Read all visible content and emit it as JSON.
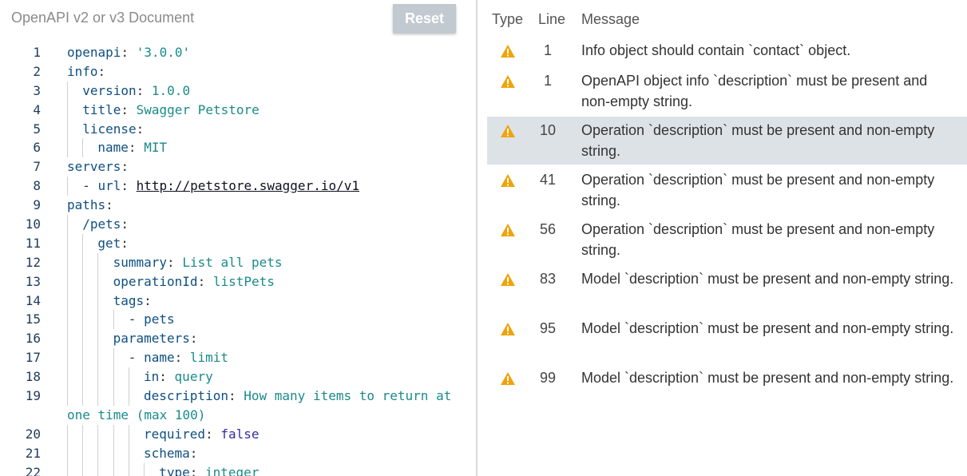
{
  "editor": {
    "title": "OpenAPI v2 or v3 Document",
    "reset_label": "Reset",
    "lines": [
      {
        "n": "1",
        "indent": 0,
        "key": "openapi",
        "value": "'3.0.0'",
        "vclass": "v"
      },
      {
        "n": "2",
        "indent": 0,
        "key": "info",
        "value": "",
        "vclass": "v"
      },
      {
        "n": "3",
        "indent": 1,
        "key": "version",
        "value": "1.0.0",
        "vclass": "v"
      },
      {
        "n": "4",
        "indent": 1,
        "key": "title",
        "value": "Swagger Petstore",
        "vclass": "v"
      },
      {
        "n": "5",
        "indent": 1,
        "key": "license",
        "value": "",
        "vclass": "v"
      },
      {
        "n": "6",
        "indent": 2,
        "key": "name",
        "value": "MIT",
        "vclass": "v"
      },
      {
        "n": "7",
        "indent": 0,
        "key": "servers",
        "value": "",
        "vclass": "v"
      },
      {
        "n": "8",
        "indent": 1,
        "dash": true,
        "key": "url",
        "value": "http://petstore.swagger.io/v1",
        "vclass": "url"
      },
      {
        "n": "9",
        "indent": 0,
        "key": "paths",
        "value": "",
        "vclass": "v"
      },
      {
        "n": "10",
        "indent": 1,
        "key": "/pets",
        "value": "",
        "vclass": "v"
      },
      {
        "n": "11",
        "indent": 2,
        "key": "get",
        "value": "",
        "vclass": "v"
      },
      {
        "n": "12",
        "indent": 3,
        "key": "summary",
        "value": "List all pets",
        "vclass": "v"
      },
      {
        "n": "13",
        "indent": 3,
        "key": "operationId",
        "value": "listPets",
        "vclass": "v"
      },
      {
        "n": "14",
        "indent": 3,
        "key": "tags",
        "value": "",
        "vclass": "v"
      },
      {
        "n": "15",
        "indent": 4,
        "dash": true,
        "plain": "pets",
        "vclass": "v"
      },
      {
        "n": "16",
        "indent": 3,
        "key": "parameters",
        "value": "",
        "vclass": "v"
      },
      {
        "n": "17",
        "indent": 4,
        "dash": true,
        "key": "name",
        "value": "limit",
        "vclass": "v"
      },
      {
        "n": "18",
        "indent": 5,
        "key": "in",
        "value": "query",
        "vclass": "v"
      },
      {
        "n": "19",
        "indent": 5,
        "key": "description",
        "value": "How many items to return at",
        "vclass": "v",
        "cont": "one time (max 100)"
      },
      {
        "n": "20",
        "indent": 5,
        "key": "required",
        "value": "false",
        "vclass": "vb"
      },
      {
        "n": "21",
        "indent": 5,
        "key": "schema",
        "value": "",
        "vclass": "v"
      },
      {
        "n": "22",
        "indent": 6,
        "key": "type",
        "value": "integer",
        "vclass": "v"
      }
    ]
  },
  "results": {
    "headers": {
      "type": "Type",
      "line": "Line",
      "message": "Message"
    },
    "warning_icon": "warning-triangle-icon",
    "warning_color": "#f0a30a",
    "selected_bg": "#dde2e7",
    "rows": [
      {
        "line": "1",
        "message": "Info object should contain `contact` object."
      },
      {
        "line": "1",
        "message": "OpenAPI object info `description` must be present and non-empty string."
      },
      {
        "line": "10",
        "message": "Operation `description` must be present and non-empty string.",
        "selected": true
      },
      {
        "line": "41",
        "message": "Operation `description` must be present and non-empty string."
      },
      {
        "line": "56",
        "message": "Operation `description` must be present and non-empty string."
      },
      {
        "line": "83",
        "message": "Model `description` must be present and non-empty string."
      },
      {
        "line": "95",
        "message": "Model `description` must be present and non-empty string."
      },
      {
        "line": "99",
        "message": "Model `description` must be present and non-empty string."
      }
    ]
  }
}
